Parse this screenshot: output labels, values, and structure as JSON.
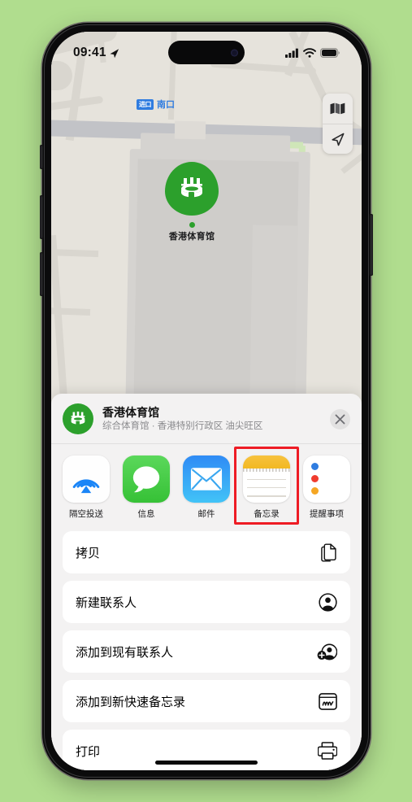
{
  "status_bar": {
    "time": "09:41",
    "location_arrow_icon": "location-arrow-icon",
    "cellular_icon": "cellular-signal-icon",
    "wifi_icon": "wifi-icon",
    "battery_icon": "battery-full-icon"
  },
  "map": {
    "exit_badge": "进口",
    "exit_label": "南口",
    "pin_label": "香港体育馆",
    "pin_icon": "stadium-icon",
    "controls": [
      {
        "name": "map-mode-button",
        "icon": "folded-map-icon"
      },
      {
        "name": "user-location-button",
        "icon": "navigation-arrow-icon"
      }
    ],
    "colors": {
      "land": "#e9e6df",
      "road": "#d9d6cf",
      "road_main": "#c2c3c7",
      "building": "#d5d3d0",
      "green_path": "#cfe6b8",
      "pin": "#2ca02c",
      "exit_blue": "#2f7ce0"
    }
  },
  "share_sheet": {
    "title": "香港体育馆",
    "subtitle": "综合体育馆 · 香港特别行政区 油尖旺区",
    "avatar_icon": "stadium-icon",
    "close_icon": "close-icon",
    "apps": [
      {
        "label": "隔空投送",
        "icon": "airdrop-icon",
        "highlighted": false
      },
      {
        "label": "信息",
        "icon": "messages-icon",
        "highlighted": false
      },
      {
        "label": "邮件",
        "icon": "mail-icon",
        "highlighted": false
      },
      {
        "label": "备忘录",
        "icon": "notes-icon",
        "highlighted": true
      },
      {
        "label": "提醒事项",
        "icon": "reminders-icon",
        "highlighted": false
      }
    ],
    "actions": [
      {
        "label": "拷贝",
        "icon": "copy-icon"
      },
      {
        "label": "新建联系人",
        "icon": "person-circle-icon"
      },
      {
        "label": "添加到现有联系人",
        "icon": "person-add-icon"
      },
      {
        "label": "添加到新快速备忘录",
        "icon": "quick-note-icon"
      },
      {
        "label": "打印",
        "icon": "printer-icon"
      }
    ],
    "highlight_color": "#ee1c25"
  },
  "page_background": "#b0dd8e"
}
